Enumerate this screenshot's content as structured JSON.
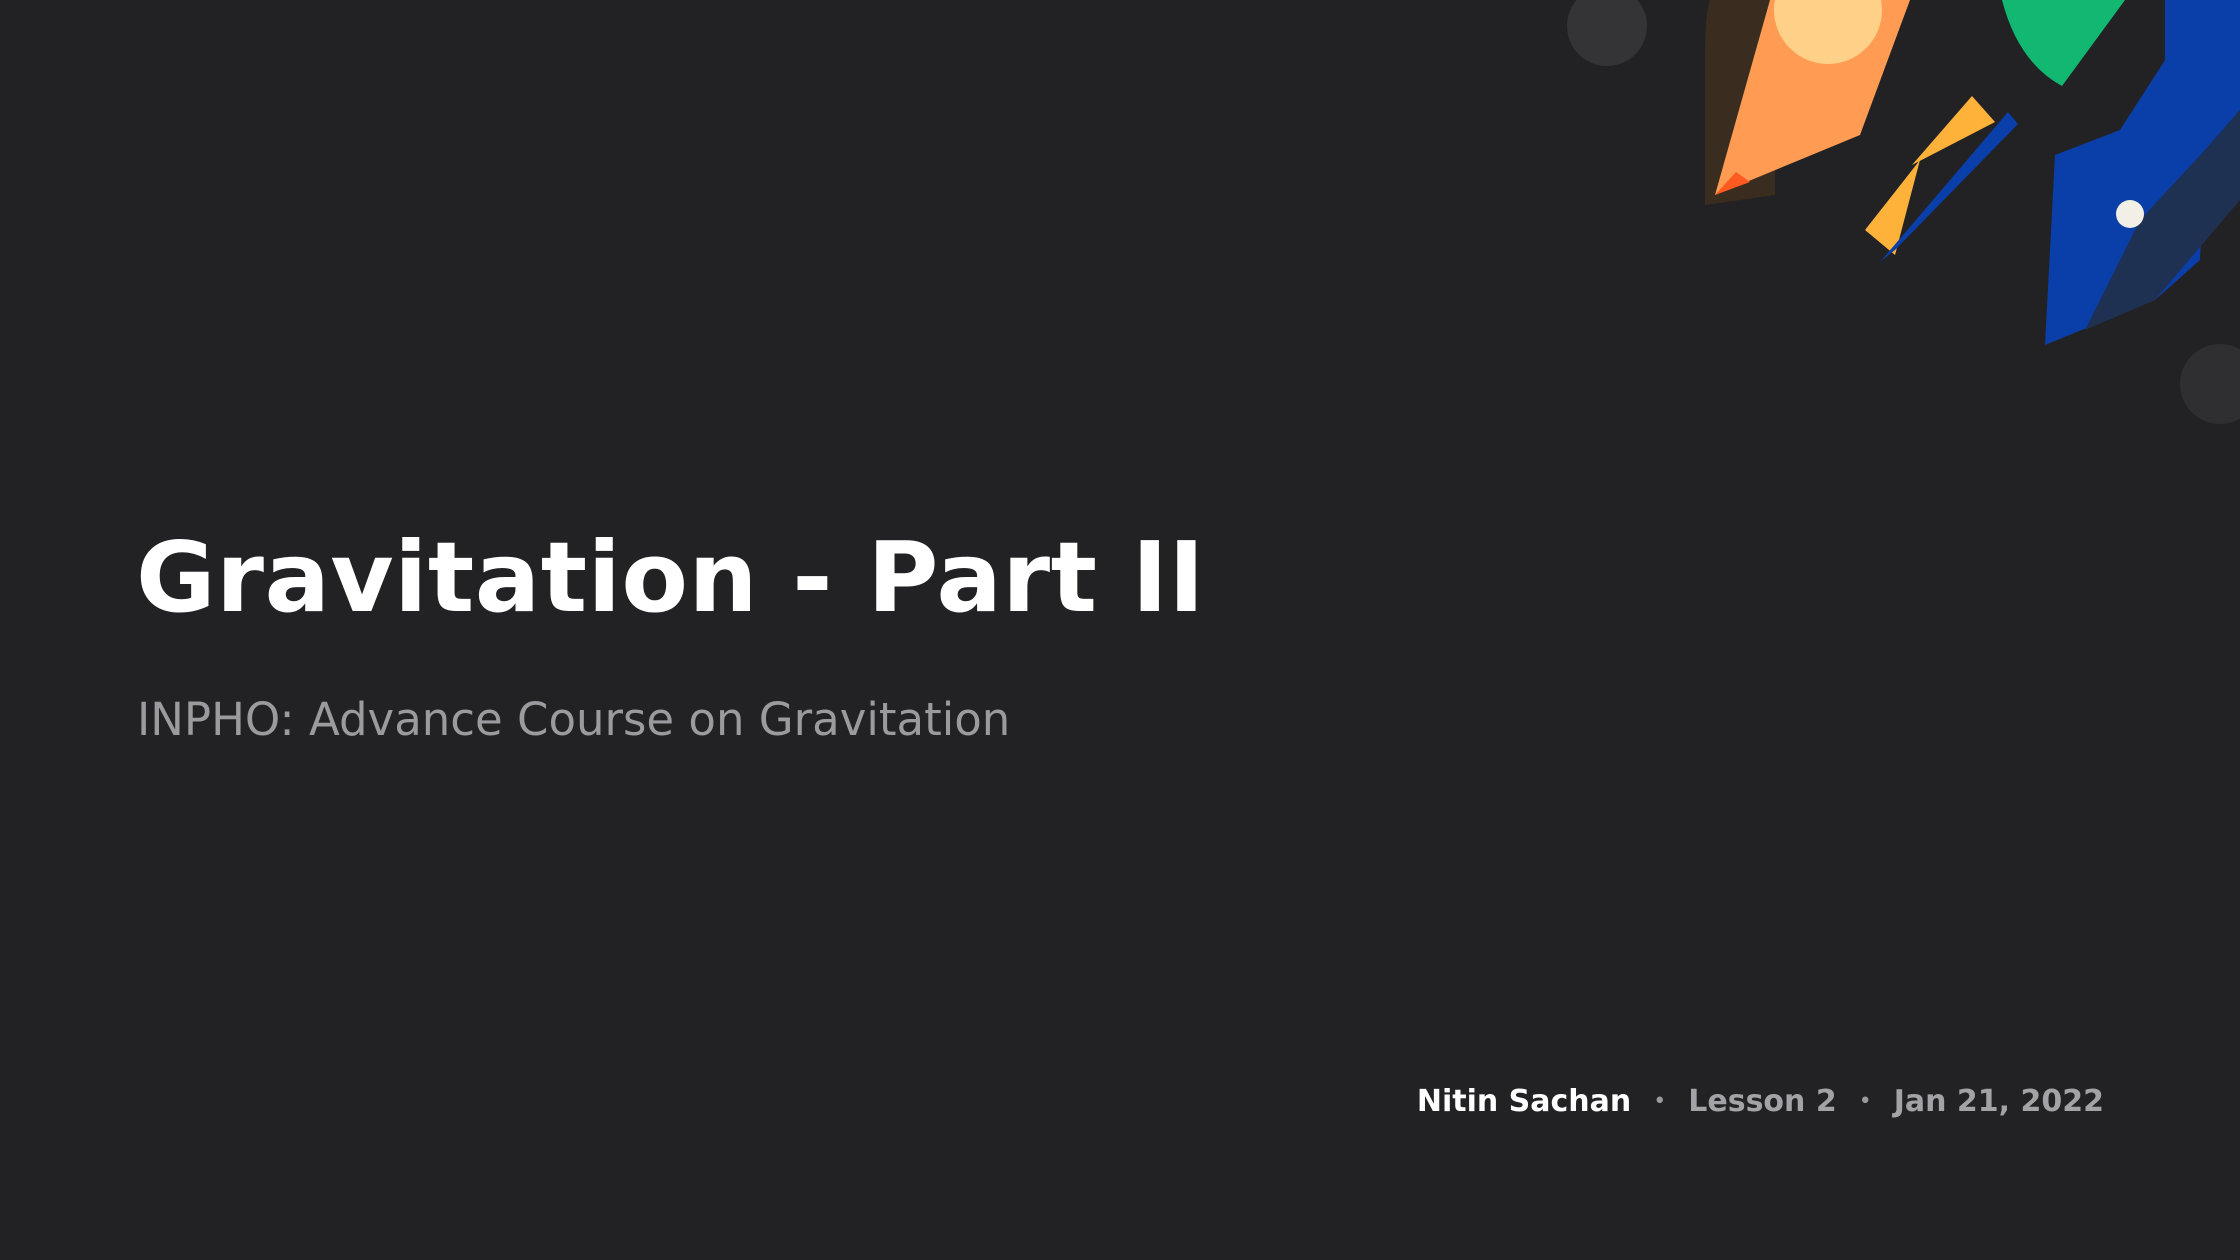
{
  "slide": {
    "title": "Gravitation - Part II",
    "subtitle": "INPHO: Advance Course on Gravitation",
    "educator": "Nitin Sachan",
    "separator": "•",
    "lesson": "Lesson 2",
    "date": "Jan 21, 2022"
  },
  "colors": {
    "background": "#222224",
    "title": "#ffffff",
    "subtitle": "#9b9b9f",
    "orange": "#ff9b52",
    "deep_orange": "#ff5a1f",
    "yellow": "#ffb23a",
    "blue": "#0a3ea8",
    "green": "#12b872",
    "pale_yellow": "#ffd992"
  }
}
